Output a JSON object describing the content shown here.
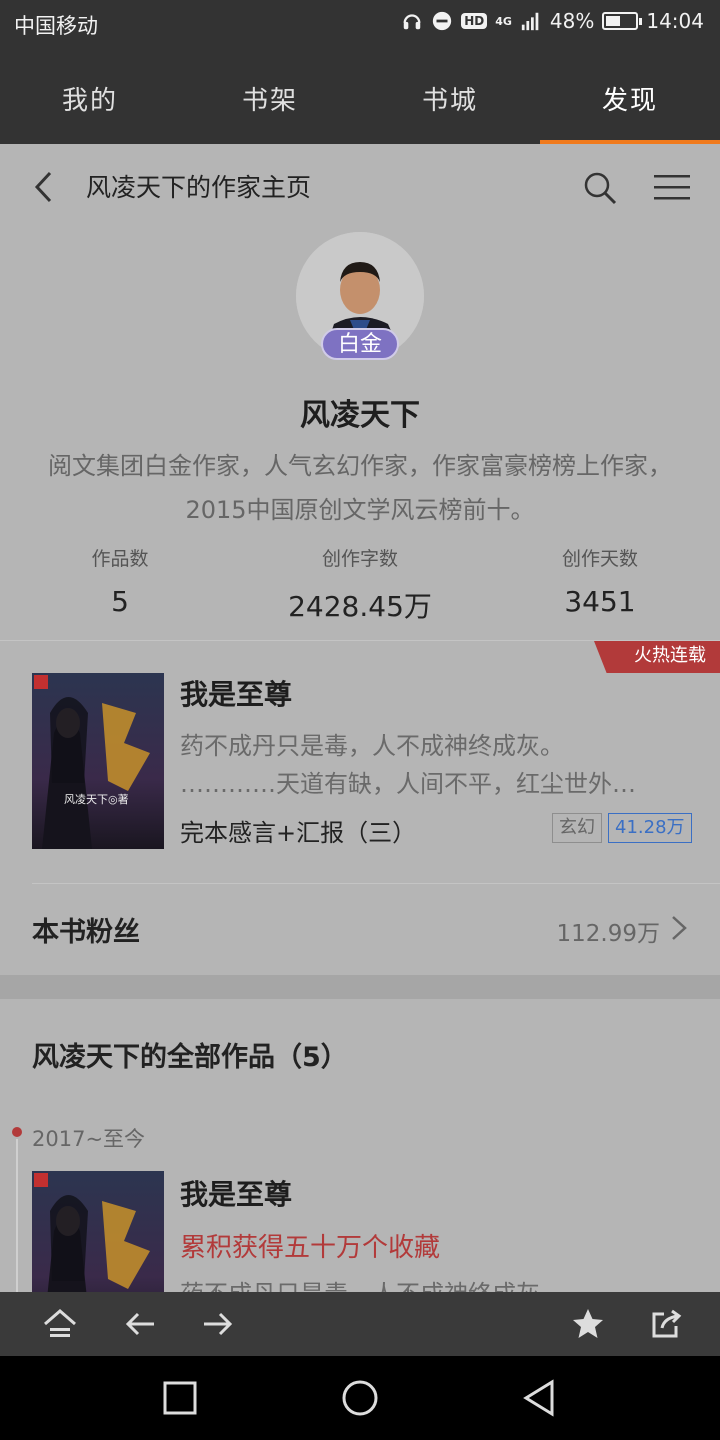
{
  "status_bar": {
    "carrier": "中国移动",
    "network": "4G",
    "hd": "HD",
    "battery": "48%",
    "battery_level": 48,
    "time": "14:04"
  },
  "top_nav": {
    "tabs": [
      {
        "label": "我的"
      },
      {
        "label": "书架"
      },
      {
        "label": "书城"
      },
      {
        "label": "发现",
        "active": true
      }
    ]
  },
  "header": {
    "title": "风凌天下的作家主页"
  },
  "author": {
    "name": "风凌天下",
    "level": "白金",
    "description": "阅文集团白金作家，人气玄幻作家，作家富豪榜榜上作家，2015中国原创文学风云榜前十。",
    "stats": [
      {
        "label": "作品数",
        "value": "5"
      },
      {
        "label": "创作字数",
        "value": "2428.45万"
      },
      {
        "label": "创作天数",
        "value": "3451"
      }
    ]
  },
  "featured_book": {
    "badge": "火热连载",
    "title": "我是至尊",
    "intro_line1": "药不成丹只是毒，人不成神终成灰。",
    "intro_line2": "…………天道有缺，人间不平，红尘世外…",
    "latest_chapter": "完本感言+汇报（三）",
    "genre": "玄幻",
    "word_count": "41.28万",
    "cover_author": "风凌天下◎著",
    "fans_label": "本书粉丝",
    "fans_count": "112.99万"
  },
  "works": {
    "title": "风凌天下的全部作品（5）",
    "timeline_date": "2017~至今",
    "items": [
      {
        "title": "我是至尊",
        "achievement": "累积获得五十万个收藏",
        "intro": "药不成丹只是毒，人不成神终成灰。"
      }
    ]
  },
  "colors": {
    "accent": "#f07a1c",
    "badge_red": "#b23a3a",
    "level_purple": "#7e72c2",
    "tag_blue": "#3a6fc4"
  },
  "icons": {
    "browser_bar": [
      "home-icon",
      "back-arrow-icon",
      "forward-arrow-icon",
      "star-icon",
      "share-icon"
    ],
    "navbar": [
      "recent-apps-icon",
      "home-circle-icon",
      "back-triangle-icon"
    ]
  }
}
